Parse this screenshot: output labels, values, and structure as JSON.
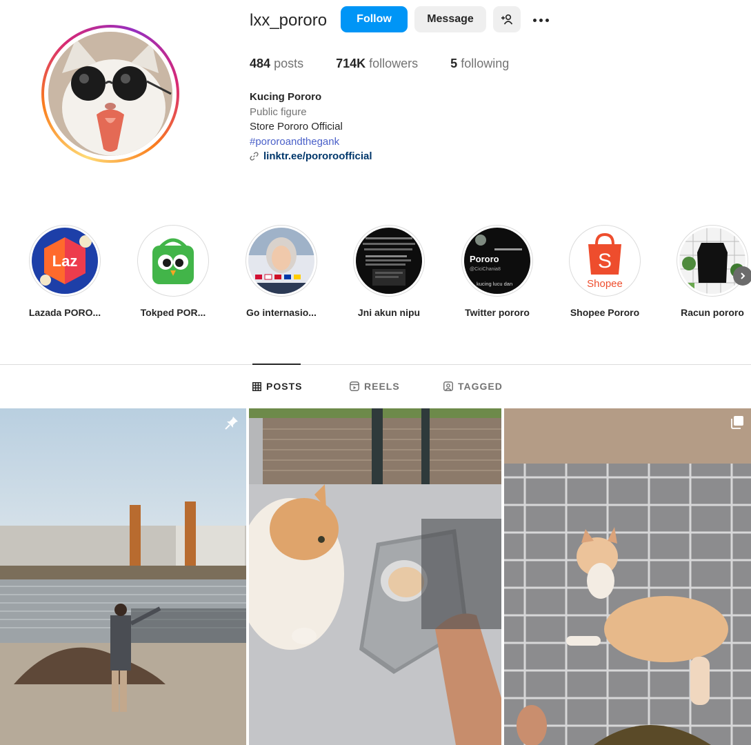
{
  "profile": {
    "username": "lxx_pororo",
    "follow_label": "Follow",
    "message_label": "Message",
    "suggest_icon": "add-person-icon",
    "more_icon": "more-options-icon",
    "stats": {
      "posts_count": "484",
      "posts_label": "posts",
      "followers_count": "714K",
      "followers_label": "followers",
      "following_count": "5",
      "following_label": "following"
    },
    "bio": {
      "full_name": "Kucing Pororo",
      "category": "Public figure",
      "line": "Store Pororo Official",
      "hashtag": "#pororoandthegank",
      "link": "linktr.ee/pororoofficial"
    }
  },
  "highlights": [
    {
      "label": "Lazada PORO..."
    },
    {
      "label": "Tokped POR..."
    },
    {
      "label": "Go internasio..."
    },
    {
      "label": "Jni akun nipu"
    },
    {
      "label": "Twitter pororo"
    },
    {
      "label": "Shopee Pororo"
    },
    {
      "label": "Racun pororo"
    }
  ],
  "highlight_text": {
    "laz": "Laz",
    "shopee": "Shopee",
    "twitter_name": "Pororo",
    "twitter_handle": "@CiciChania8",
    "twitter_caption": "kucing lucu dan"
  },
  "tabs": [
    {
      "label": "POSTS",
      "icon": "grid-icon",
      "active": true
    },
    {
      "label": "REELS",
      "icon": "reels-icon",
      "active": false
    },
    {
      "label": "TAGGED",
      "icon": "tagged-icon",
      "active": false
    }
  ],
  "posts": [
    {
      "badge": "pin-icon"
    },
    {
      "badge": ""
    },
    {
      "badge": "carousel-icon"
    }
  ],
  "colors": {
    "accent": "#0095f6",
    "link": "#00376b",
    "hashtag": "#4a60c9"
  }
}
